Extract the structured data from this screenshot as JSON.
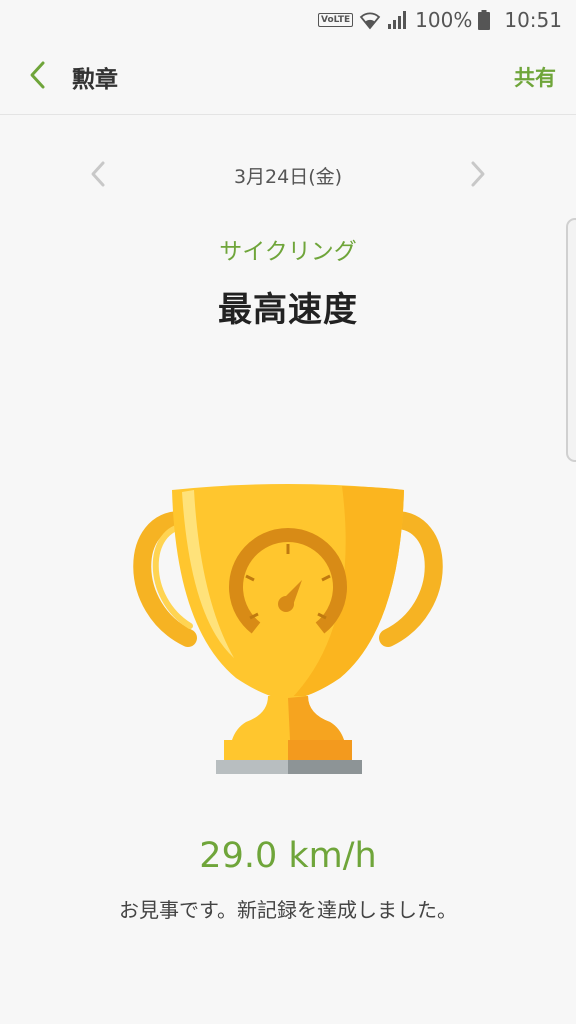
{
  "status_bar": {
    "volte": "VoLTE",
    "battery_percent": "100%",
    "time": "10:51",
    "icons": [
      "wifi-icon",
      "signal-icon",
      "battery-icon"
    ]
  },
  "app_bar": {
    "back_icon": "chevron-left-icon",
    "title": "勲章",
    "share_label": "共有"
  },
  "date_nav": {
    "prev_icon": "chevron-left-icon",
    "label": "3月24日(金)",
    "next_icon": "chevron-right-icon"
  },
  "badge": {
    "category": "サイクリング",
    "title": "最高速度",
    "icon": "trophy-speedometer-icon",
    "value": "29.0 km/h",
    "message": "お見事です。新記録を達成しました。"
  },
  "colors": {
    "accent": "#6fa53a",
    "background": "#f7f7f7",
    "trophy_gold": "#ffc62e"
  }
}
